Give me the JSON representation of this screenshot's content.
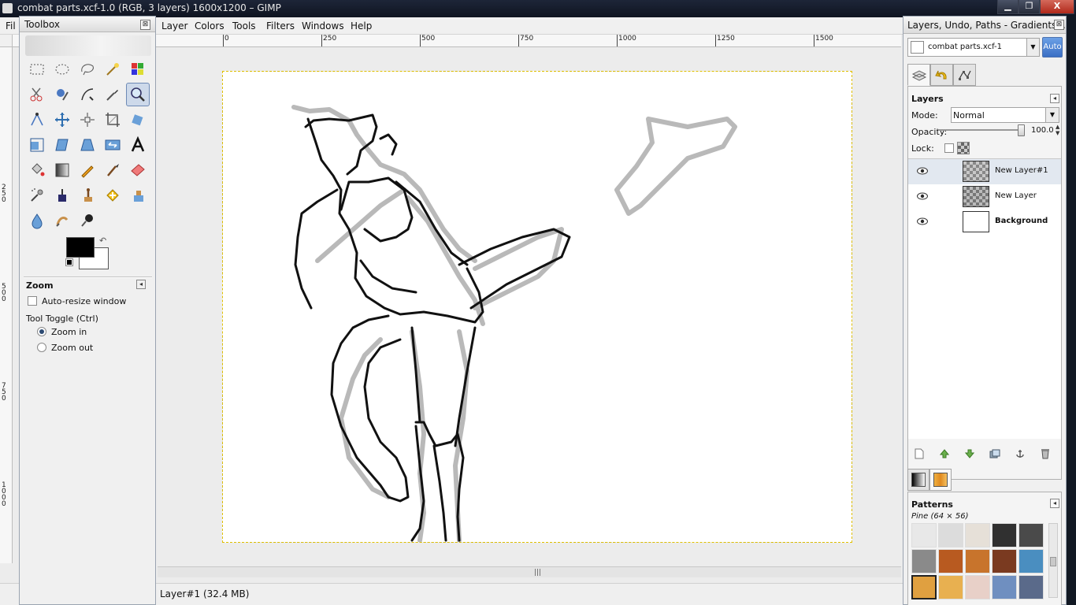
{
  "window": {
    "title": "combat parts.xcf-1.0 (RGB, 3 layers) 1600x1200 – GIMP",
    "min_label": "▁",
    "max_label": "❐",
    "close_label": "X"
  },
  "menubar": {
    "items": [
      {
        "label": "File",
        "shown": "Fil"
      },
      {
        "label": "Layer"
      },
      {
        "label": "Colors"
      },
      {
        "label": "Tools"
      },
      {
        "label": "Filters"
      },
      {
        "label": "Windows"
      },
      {
        "label": "Help"
      }
    ]
  },
  "ruler": {
    "h_ticks": [
      "0",
      "250",
      "500",
      "750",
      "1000",
      "1250",
      "1500"
    ],
    "v_ticks": [
      "2 5 0",
      "5 0 0",
      "7 5 0",
      "1 0 0 0"
    ]
  },
  "statusbar": {
    "message": "Layer#1 (32.4 MB)"
  },
  "toolbox": {
    "title": "Toolbox",
    "close": "⊠",
    "tools": [
      "rect-select",
      "ellipse-select",
      "free-select",
      "fuzzy-select",
      "color-select",
      "scissors",
      "foreground-select",
      "paths",
      "color-picker",
      "zoom",
      "measure",
      "move",
      "align",
      "crop",
      "rotate",
      "scale",
      "shear",
      "perspective",
      "flip",
      "text",
      "bucket-fill",
      "blend",
      "pencil",
      "paintbrush",
      "eraser",
      "airbrush",
      "ink",
      "clone",
      "heal",
      "perspective-clone",
      "blur",
      "smudge",
      "dodge-burn"
    ],
    "active_tool": "zoom",
    "swap_glyph": "↶",
    "options": {
      "title": "Zoom",
      "auto_resize_label": "Auto-resize window",
      "auto_resize_checked": false,
      "toggle_label": "Tool Toggle  (Ctrl)",
      "zoom_in_label": "Zoom in",
      "zoom_out_label": "Zoom out",
      "selected_direction": "zoom-in"
    }
  },
  "dock": {
    "title": "Layers, Undo, Paths - Gradients, ...",
    "close": "⊠",
    "image_select": "combat parts.xcf-1",
    "auto_label": "Auto",
    "tabs": [
      "layers",
      "undo",
      "paths"
    ],
    "layers": {
      "title": "Layers",
      "mode_label": "Mode:",
      "mode_value": "Normal",
      "opacity_label": "Opacity:",
      "opacity_value": "100.0",
      "lock_label": "Lock:",
      "items": [
        {
          "name": "New Layer#1",
          "visible": true,
          "thumb": "checker",
          "selected": true
        },
        {
          "name": "New Layer",
          "visible": true,
          "thumb": "sketch",
          "selected": false
        },
        {
          "name": "Background",
          "visible": true,
          "thumb": "white",
          "selected": false
        }
      ]
    },
    "patterns": {
      "title": "Patterns",
      "selected_name": "Pine (64 × 56)",
      "swatch_colors": [
        [
          "#e8e8e8",
          "#dcdcdc",
          "#e6e0d8",
          "#303030",
          "#4a4a4a"
        ],
        [
          "#8a8a8a",
          "#b85a20",
          "#c8742c",
          "#7a3a20",
          "#4a8ec0"
        ],
        [
          "#e0a040",
          "#e8b050",
          "#e8d0c8",
          "#6f8fc0",
          "#5a6a8a"
        ]
      ]
    }
  },
  "colors": {
    "accent": "#3a6fc4",
    "title_bar": "#0f1420",
    "selection_border": "#e0c000"
  }
}
